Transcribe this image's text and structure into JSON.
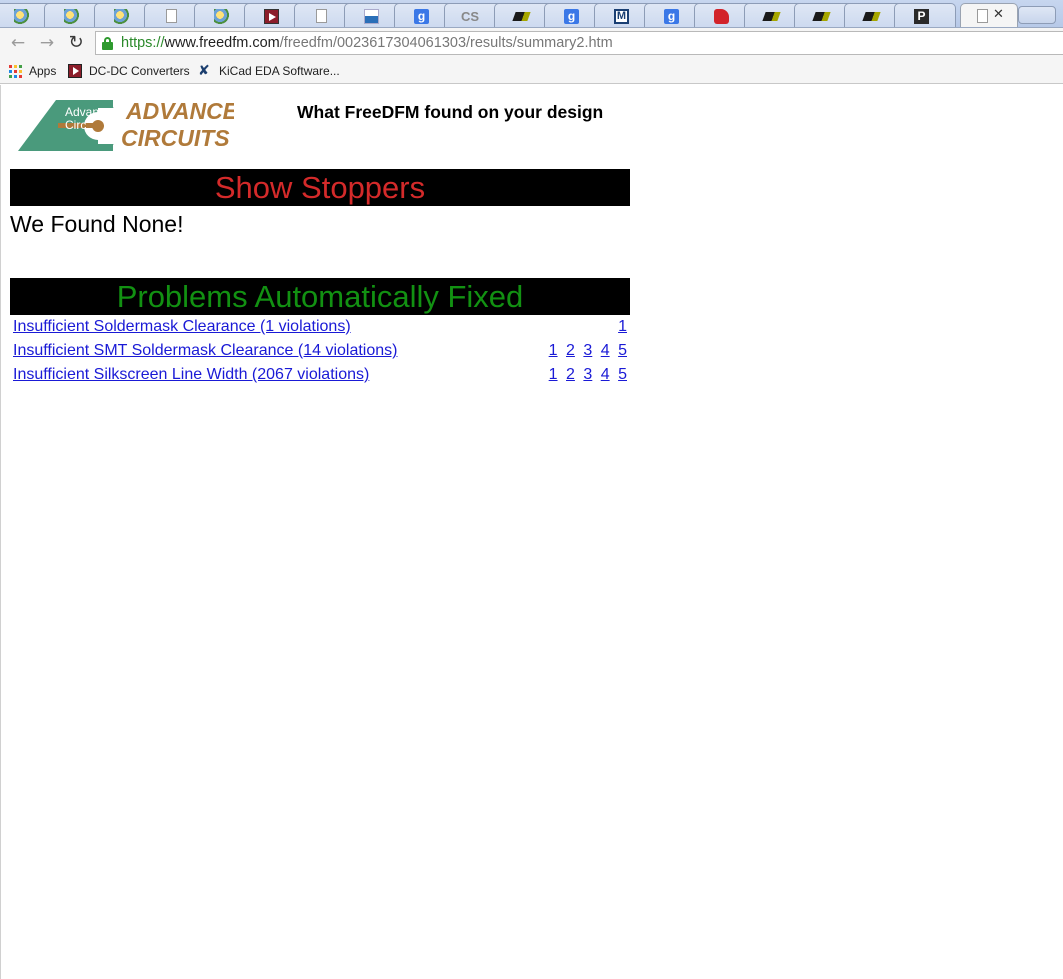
{
  "browser": {
    "tabs": [
      {
        "icon": "leaf-icon"
      },
      {
        "icon": "leaf-icon"
      },
      {
        "icon": "leaf-icon"
      },
      {
        "icon": "document-icon"
      },
      {
        "icon": "leaf-icon"
      },
      {
        "icon": "red-arrow-icon"
      },
      {
        "icon": "document-icon"
      },
      {
        "icon": "vishay-icon"
      },
      {
        "icon": "google-icon"
      },
      {
        "icon": "cs-icon"
      },
      {
        "icon": "p-logo-icon"
      },
      {
        "icon": "google-icon"
      },
      {
        "icon": "m-logo-icon"
      },
      {
        "icon": "google-icon"
      },
      {
        "icon": "red-plug-icon"
      },
      {
        "icon": "p-logo-icon"
      },
      {
        "icon": "p-logo-icon"
      },
      {
        "icon": "p-logo-icon"
      },
      {
        "icon": "p-dark-icon"
      },
      {
        "icon": "document-icon",
        "active": true
      }
    ],
    "tab_text": {
      "google": "g",
      "cs": "CS",
      "m": "M",
      "pdark": "P",
      "close": "✕"
    },
    "address": {
      "scheme": "https://",
      "host": "www.freedfm.com",
      "path": "/freedfm/0023617304061303/results/summary2.htm"
    },
    "bookmarks": [
      {
        "label": "Apps",
        "icon": "apps-grid-icon"
      },
      {
        "label": "DC-DC Converters",
        "icon": "dcdc-icon"
      },
      {
        "label": "KiCad EDA Software...",
        "icon": "kicad-icon"
      }
    ]
  },
  "page": {
    "logo": {
      "alt_text": "Advanced Circ",
      "wordmark_line1": "ADVANCED",
      "wordmark_line2": "CIRCUITS"
    },
    "title": "What FreeDFM found on your design",
    "show_stoppers": {
      "heading": "Show Stoppers",
      "message": "We Found None!"
    },
    "auto_fixed": {
      "heading": "Problems Automatically Fixed",
      "problems": [
        {
          "label": "Insufficient Soldermask Clearance (1 violations)",
          "pages": [
            "1"
          ]
        },
        {
          "label": "Insufficient SMT Soldermask Clearance (14 violations)",
          "pages": [
            "1",
            "2",
            "3",
            "4",
            "5"
          ]
        },
        {
          "label": "Insufficient Silkscreen Line Width (2067 violations)",
          "pages": [
            "1",
            "2",
            "3",
            "4",
            "5"
          ]
        }
      ]
    }
  },
  "colors": {
    "stoppers_heading": "#d42a2a",
    "fixed_heading": "#129112",
    "link": "#1a1ad6",
    "banner_bg": "#000000",
    "secure_green": "#2e9a2e"
  }
}
